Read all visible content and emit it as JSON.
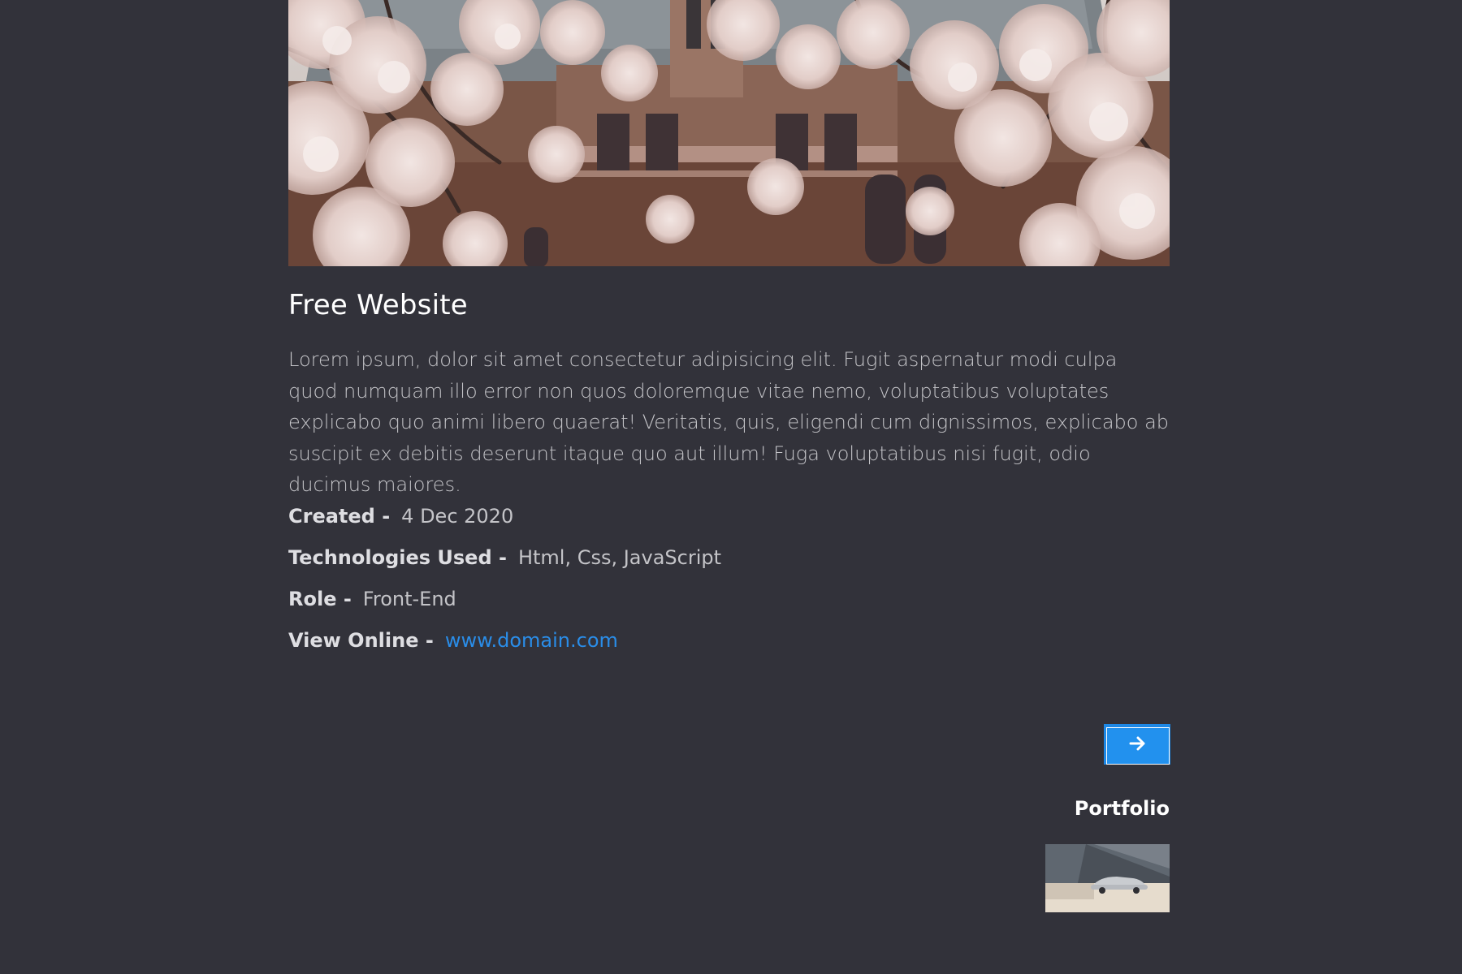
{
  "project": {
    "title": "Free Website",
    "description": "Lorem ipsum, dolor sit amet consectetur adipisicing elit. Fugit aspernatur modi culpa quod numquam illo error non quos doloremque vitae nemo, voluptatibus voluptates explicabo quo animi libero quaerat! Veritatis, quis, eligendi cum dignissimos, explicabo ab suscipit ex debitis deserunt itaque quo aut illum! Fuga voluptatibus nisi fugit, odio ducimus maiores.",
    "details": {
      "created_label": "Created -",
      "created_value": "4 Dec 2020",
      "tech_label": "Technologies Used -",
      "tech_value": "Html, Css, JavaScript",
      "role_label": "Role -",
      "role_value": "Front-End",
      "online_label": "View Online -",
      "online_value": "www.domain.com"
    }
  },
  "navigation": {
    "next_icon": "arrow-right-icon"
  },
  "portfolio": {
    "label": "Portfolio"
  },
  "colors": {
    "background": "#32323a",
    "accent": "#2291ee",
    "link": "#2a8de8"
  }
}
